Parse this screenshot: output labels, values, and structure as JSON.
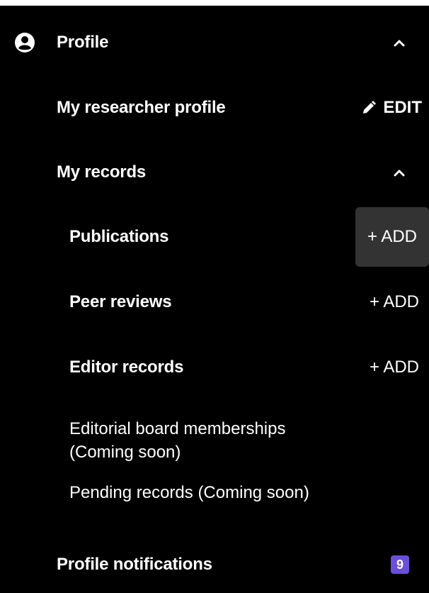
{
  "profile": {
    "label": "Profile",
    "chevron_icon": "chevron-up-icon",
    "user_icon": "user-circle-icon"
  },
  "researcher_profile": {
    "label": "My researcher profile",
    "edit_label": "EDIT",
    "edit_icon": "pencil-icon"
  },
  "my_records": {
    "label": "My records",
    "chevron_icon": "chevron-up-icon",
    "items": [
      {
        "label": "Publications",
        "action": "+ ADD"
      },
      {
        "label": "Peer reviews",
        "action": "+ ADD"
      },
      {
        "label": "Editor records",
        "action": "+ ADD"
      }
    ],
    "editorial_board": {
      "line1": "Editorial board memberships",
      "line2": "(Coming soon)"
    },
    "pending": "Pending records (Coming soon)"
  },
  "notifications": {
    "label": "Profile notifications",
    "count": "9",
    "badge_color": "#6b4fd8"
  },
  "colors": {
    "background": "#000000",
    "text": "#ffffff",
    "hover": "#333333"
  }
}
